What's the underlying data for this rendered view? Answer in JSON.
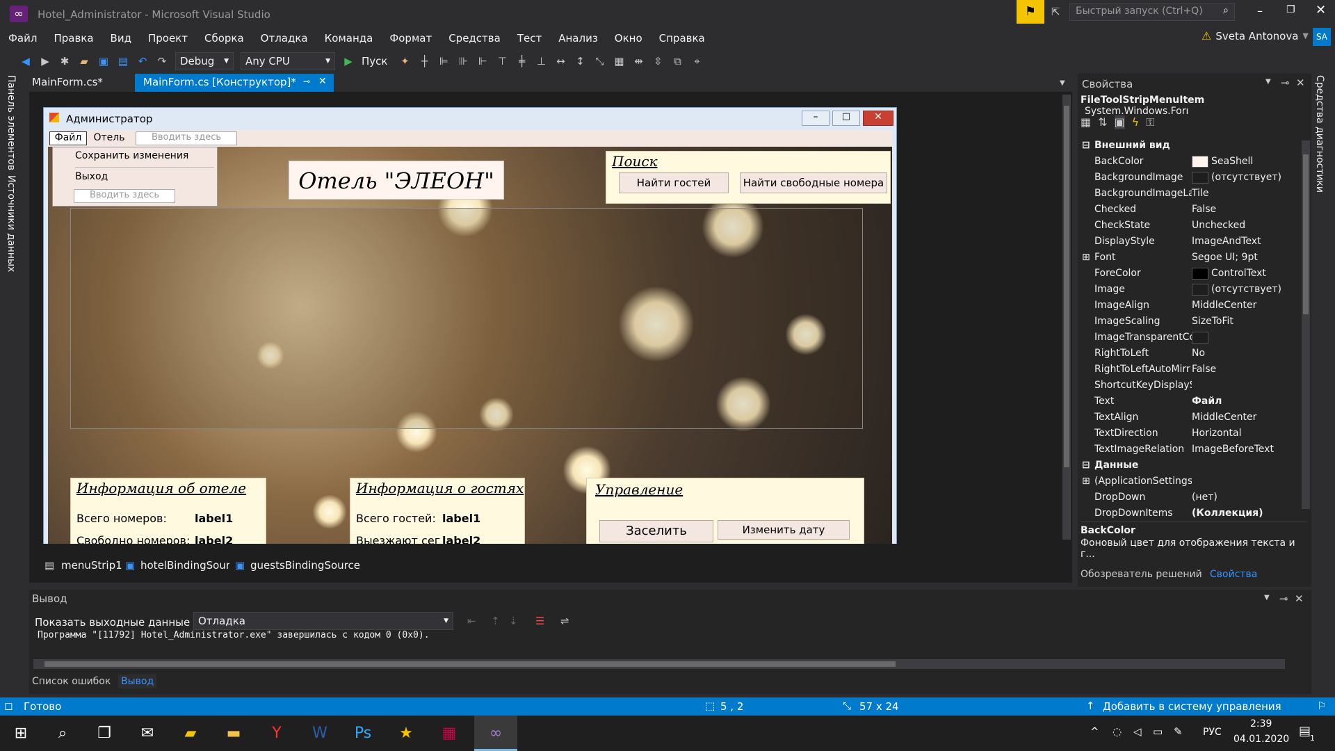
{
  "title": {
    "window_title": "Hotel_Administrator - Microsoft Visual Studio",
    "quick_launch": "Быстрый запуск (Ctrl+Q)",
    "user": "Sveta Antonova",
    "user_initials": "SA"
  },
  "menu": [
    "Файл",
    "Правка",
    "Вид",
    "Проект",
    "Сборка",
    "Отладка",
    "Команда",
    "Формат",
    "Средства",
    "Тест",
    "Анализ",
    "Окно",
    "Справка"
  ],
  "toolbar": {
    "config": "Debug",
    "platform": "Any CPU",
    "run": "Пуск"
  },
  "left_tabs": [
    "Панель элементов",
    "Источники данных"
  ],
  "tabs": [
    {
      "label": "MainForm.cs*"
    },
    {
      "label": "MainForm.cs [Конструктор]*"
    }
  ],
  "form": {
    "title": "Администратор",
    "menu": [
      "Файл",
      "Отель"
    ],
    "menu_placeholder": "Вводить здесь",
    "dropdown": [
      "Сохранить изменения",
      "Выход"
    ],
    "dropdown_placeholder": "Вводить здесь",
    "hotel_title": "Отель \"ЭЛЕОН\"",
    "search": {
      "legend": "Поиск",
      "btn_guests": "Найти гостей",
      "btn_rooms": "Найти свободные номера"
    },
    "hotel_info": {
      "legend": "Информация об отеле",
      "total_label": "Всего номеров:",
      "total_value": "label1",
      "free_label": "Свободно номеров:",
      "free_value": "label2"
    },
    "guest_info": {
      "legend": "Информация о гостях",
      "total_label": "Всего гостей:",
      "total_value": "label1",
      "leaving_label": "Выезжают сег",
      "leaving_value": "label2"
    },
    "manage": {
      "legend": "Управление",
      "btn_checkin": "Заселить",
      "btn_change": "Изменить дату отъезда"
    }
  },
  "tray": [
    "menuStrip1",
    "hotelBindingSourc",
    "guestsBindingSource"
  ],
  "props": {
    "header": "Свойства",
    "object": "FileToolStripMenuItem",
    "type": "System.Windows.Forı",
    "cat1": "Внешний вид",
    "rows": [
      {
        "name": "BackColor",
        "value": "SeaShell",
        "swatch": "#fff5ee"
      },
      {
        "name": "BackgroundImage",
        "value": "(отсутствует)",
        "swatch": "#1e1e1e"
      },
      {
        "name": "BackgroundImageLa",
        "value": "Tile"
      },
      {
        "name": "Checked",
        "value": "False"
      },
      {
        "name": "CheckState",
        "value": "Unchecked"
      },
      {
        "name": "DisplayStyle",
        "value": "ImageAndText"
      },
      {
        "name": "Font",
        "value": "Segoe UI; 9pt",
        "expand": true
      },
      {
        "name": "ForeColor",
        "value": "ControlText",
        "swatch": "#000000"
      },
      {
        "name": "Image",
        "value": "(отсутствует)",
        "swatch": "#1e1e1e"
      },
      {
        "name": "ImageAlign",
        "value": "MiddleCenter"
      },
      {
        "name": "ImageScaling",
        "value": "SizeToFit"
      },
      {
        "name": "ImageTransparentCo",
        "value": "",
        "swatch": "#1e1e1e"
      },
      {
        "name": "RightToLeft",
        "value": "No"
      },
      {
        "name": "RightToLeftAutoMirr",
        "value": "False"
      },
      {
        "name": "ShortcutKeyDisplayS",
        "value": ""
      },
      {
        "name": "Text",
        "value": "Файл",
        "bold": true
      },
      {
        "name": "TextAlign",
        "value": "MiddleCenter"
      },
      {
        "name": "TextDirection",
        "value": "Horizontal"
      },
      {
        "name": "TextImageRelation",
        "value": "ImageBeforeText"
      }
    ],
    "cat2": "Данные",
    "rows2": [
      {
        "name": "(ApplicationSettings",
        "value": "",
        "expand": true
      },
      {
        "name": "DropDown",
        "value": "(нет)"
      },
      {
        "name": "DropDownItems",
        "value": "(Коллекция)",
        "bold": true
      }
    ],
    "desc_title": "BackColor",
    "desc_text": "Фоновый цвет для отображения текста и г...",
    "bottom_tabs": [
      "Обозреватель решений",
      "Свойства"
    ]
  },
  "right_tab": "Средства диагностики",
  "output": {
    "header": "Вывод",
    "show_label": "Показать выходные данные из:",
    "source": "Отладка",
    "text": "Программа \"[11792] Hotel_Administrator.exe\" завершилась с кодом 0 (0x0).",
    "tabs": [
      "Список ошибок",
      "Вывод"
    ]
  },
  "status": {
    "ready": "Готово",
    "pos": "5 , 2",
    "size": "57 x 24",
    "vcs": "Добавить в систему управления версиями"
  },
  "taskbar": {
    "time": "2:39",
    "date": "04.01.2020",
    "lang": "РУС",
    "notif_count": "1"
  }
}
